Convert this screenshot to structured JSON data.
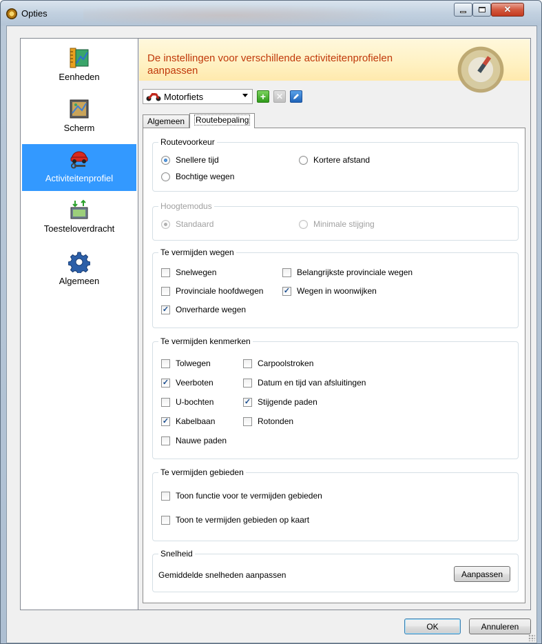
{
  "window": {
    "title": "Opties"
  },
  "sidebar": {
    "items": [
      {
        "label": "Eenheden",
        "icon": "ruler-map-icon",
        "active": false
      },
      {
        "label": "Scherm",
        "icon": "screen-map-icon",
        "active": false
      },
      {
        "label": "Activiteitenprofiel",
        "icon": "car-wrench-icon",
        "active": true
      },
      {
        "label": "Toesteloverdracht",
        "icon": "device-transfer-icon",
        "active": false
      },
      {
        "label": "Algemeen",
        "icon": "gear-icon",
        "active": false
      }
    ]
  },
  "banner": {
    "text": "De instellingen voor verschillende activiteitenprofielen aanpassen"
  },
  "profile": {
    "selected": "Motorfiets"
  },
  "tabs": [
    {
      "label": "Algemeen",
      "active": false
    },
    {
      "label": "Routebepaling",
      "active": true
    }
  ],
  "routevoorkeur": {
    "title": "Routevoorkeur",
    "options": [
      {
        "label": "Snellere tijd",
        "selected": true
      },
      {
        "label": "Kortere afstand",
        "selected": false
      },
      {
        "label": "Bochtige wegen",
        "selected": false
      }
    ]
  },
  "hoogtemodus": {
    "title": "Hoogtemodus",
    "options": [
      {
        "label": "Standaard",
        "selected": true
      },
      {
        "label": "Minimale stijging",
        "selected": false
      }
    ]
  },
  "wegen": {
    "title": "Te vermijden wegen",
    "options": [
      {
        "label": "Snelwegen",
        "checked": false
      },
      {
        "label": "Belangrijkste provinciale wegen",
        "checked": false
      },
      {
        "label": "Provinciale hoofdwegen",
        "checked": false
      },
      {
        "label": "Wegen in woonwijken",
        "checked": true
      },
      {
        "label": "Onverharde wegen",
        "checked": true
      }
    ]
  },
  "kenmerken": {
    "title": "Te vermijden kenmerken",
    "options": [
      {
        "label": "Tolwegen",
        "checked": false
      },
      {
        "label": "Carpoolstroken",
        "checked": false
      },
      {
        "label": "Veerboten",
        "checked": true
      },
      {
        "label": "Datum en tijd van afsluitingen",
        "checked": false
      },
      {
        "label": "U-bochten",
        "checked": false
      },
      {
        "label": "Stijgende paden",
        "checked": true
      },
      {
        "label": "Kabelbaan",
        "checked": true
      },
      {
        "label": "Rotonden",
        "checked": false
      },
      {
        "label": "Nauwe paden",
        "checked": false
      }
    ]
  },
  "gebieden": {
    "title": "Te vermijden gebieden",
    "options": [
      {
        "label": "Toon functie voor te vermijden gebieden",
        "checked": false
      },
      {
        "label": "Toon te vermijden gebieden op kaart",
        "checked": false
      }
    ]
  },
  "snelheid": {
    "title": "Snelheid",
    "description": "Gemiddelde snelheden aanpassen",
    "button": "Aanpassen"
  },
  "footer": {
    "ok": "OK",
    "cancel": "Annuleren"
  },
  "check_mark": "✓"
}
